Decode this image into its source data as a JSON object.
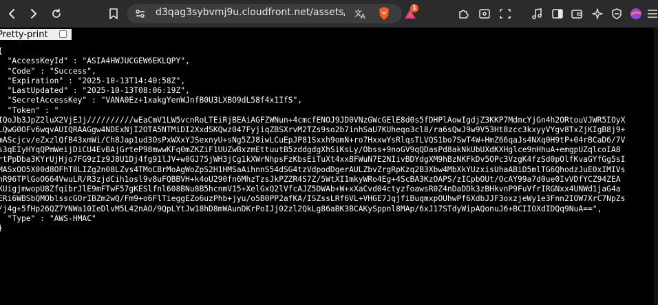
{
  "browser": {
    "url": "d3qag3sybvmj9u.cloudfront.net/assets/pu…",
    "notification_count": "1"
  },
  "viewer": {
    "pretty_print_label": "Pretty-print",
    "pretty_print_checked": false
  },
  "json_lines": [
    "{",
    "  \"AccessKeyId\" : \"ASIA4HWJUCGEW6EKLQPY\",",
    "  \"Code\" : \"Success\",",
    "  \"Expiration\" : \"2025-10-13T14:40:58Z\",",
    "  \"LastUpdated\" : \"2025-10-13T08:06:19Z\",",
    "  \"SecretAccessKey\" : \"VANA0Ez+1xakgYenWJnfB0U3LXBO9dL58f4x1IfS\",",
    "  \"Token\" : \"",
    "IQoJb3JpZ2luX2VjEJj//////////wEaCmV1LW5vcnRoLTEiRjBEAiAGFZWNun+4cmcfENOJ9JD0VNzGWcGElE8d0s5fDHPlAowIgdjZ3KKP7MdmcYjGn4h2ORtouVJWR5IOyX",
    "LQwG0OFv6wqvAUIQRAAGgw4NDExNjI2OTA5NTMiDI2XxdSKQwz047FyjiqZBSXrvM2TZs9so2b7inhSaU7KUheqo3cl8/ra6sQwJ9w9V53Ht8zcc3kxyyVYgv8TxZjKIgB8j9+",
    "mAScjcv/eZxzlQfB43xmWi/Ch8Jap1ud3OsPxWXxYJSexnyU+sNg5ZJ8iwLCuEpJP81Sxxh9omN+ro7HxxwYsRlqsTLVQS1bo7SwT4W+HmZ66qaJs4NXq0H9tP+04rBCaD6/7V",
    "s3qEIyHYqQPmWeijDiCU4EvBAjGrteP98mwwKFq0mZKZiF1UUZwBxzmEttuutB5zddgdgXhSiKsLy/Obss+9noGV9qQDasPd8akNkUbUXdKXHglce9nHhuA+emgpUZqlcoIA8",
    "rtPpDba3KYrUjHjo7FG9zIz9J8U1Dj4fg91lJV+w0GJ75jWH3jCg1kXWrNhpsFzKbsEiTuXt4xxBFWuN7E2NIivBDYdgXM9hBzNKFkDv5OPc3VzgK4fzSd0pOlfKvaGYfGg5sI",
    "MASxOO5X00d8OFhT8LIZg2n08LZvs4TMoCBrMoAgWoZpS2H1HMSaAihnnS54dSG4tzVdpodDgerAULZbvZrgRpKzq2B3Xbw4MbXkYUzxisUhaABiD5mlTG6QhodzJuE0xIMIVs",
    "nR96TPlGoO664VwuLR/R3zjdCih1osl9v8uFQBBVH+k4oU290fn6MhzTzsJkPZZR4S7Z/5WtXI1mkyWRo4Eg+4ScBA3KzOAPS/zICpbOUt/OcAY99a7d0ue0IvVDfYCZ94ZEA",
    "XUigjmwopU8ZfqibrJlE9mFTwF57gKESlfnl608BNu8B5hcnmV15+XelGxQ2lVfcAJZ5DWAb+W+xXaCvd04ctyzfoawsR0Z4nDaDDk3zBHkvnP9FuVfrIRGNxx4UNWd1jaG4a",
    "ERi6WBSbQMOblsscGOrIBZm2wQ/Fm9+o6FlTieggEZo6uzPhb+jyu/o5B0PP2afKA/ISZssLRf6VL+VHGE7JqjfiBuqmxpOUhwPf6XdbJJF3oxzjeWy1e3Fnn2IOW7XrC7NpZs",
    "/j4g+5fHp26QZ7YNWa10IeDlvM5L42nAO/9QpLYtJw18hD8mWAunDKrPoIJj02zl2QkLg86aBK3BCAKySppnl8MAp/6xJ17STdyWipAQonuJ6+BCIIOXdIDQq9NuA==\",",
    "  \"Type\" : \"AWS-HMAC\"",
    "}"
  ]
}
